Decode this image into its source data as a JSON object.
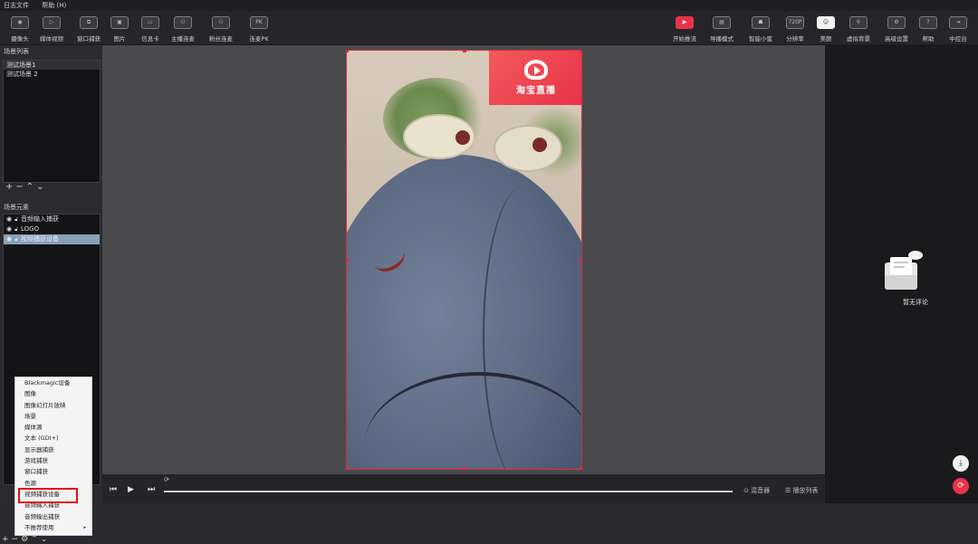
{
  "menu": [
    "日志文件",
    "帮助 (H)"
  ],
  "toolbar_left": [
    {
      "label": "摄像头",
      "icon": "camera-icon",
      "glyph": "◉"
    },
    {
      "label": "媒体视频",
      "icon": "media-play-icon",
      "glyph": "▷"
    },
    {
      "label": "窗口捕获",
      "icon": "window-capture-icon",
      "glyph": "⧉"
    },
    {
      "label": "图片",
      "icon": "image-icon",
      "glyph": "▣"
    },
    {
      "label": "信息卡",
      "icon": "info-card-icon",
      "glyph": "▭"
    },
    {
      "label": "主播连麦",
      "icon": "host-link-icon",
      "glyph": "⚇"
    },
    {
      "label": "粉丝连麦",
      "icon": "fan-link-icon",
      "glyph": "⚇"
    },
    {
      "label": "连麦PK",
      "icon": "pk-icon",
      "glyph": "PK"
    }
  ],
  "toolbar_right": [
    {
      "label": "开始推流",
      "icon": "start-stream-icon",
      "glyph": "▶",
      "style": "red"
    },
    {
      "label": "导播模式",
      "icon": "director-mode-icon",
      "glyph": "▤",
      "style": ""
    },
    {
      "label": "智能小蜜",
      "icon": "assistant-icon",
      "glyph": "☗",
      "style": ""
    },
    {
      "label": "分辨率",
      "icon": "resolution-icon",
      "glyph": "720P",
      "style": ""
    },
    {
      "label": "美颜",
      "icon": "beauty-icon",
      "glyph": "☺",
      "style": "white"
    },
    {
      "label": "虚拟背景",
      "icon": "virtual-bg-icon",
      "glyph": "⚲",
      "style": ""
    },
    {
      "label": "高级设置",
      "icon": "settings-icon",
      "glyph": "⚙",
      "style": ""
    },
    {
      "label": "帮助",
      "icon": "help-icon",
      "glyph": "?",
      "style": ""
    },
    {
      "label": "中控台",
      "icon": "console-icon",
      "glyph": "⇥",
      "style": ""
    }
  ],
  "scenes": {
    "title": "场景列表",
    "items": [
      "测试场景1",
      "测试场景 2"
    ]
  },
  "elements": {
    "title": "场景元素",
    "items": [
      "音频输入捕获",
      "LOGO",
      "视频捕获设备"
    ]
  },
  "context_menu": [
    "Blackmagic设备",
    "图像",
    "图像幻灯片放映",
    "场景",
    "媒体源",
    "文本 (GDI+)",
    "显示器捕获",
    "游戏捕获",
    "窗口捕获",
    "色源",
    "视频捕获设备",
    "音频输入捕获",
    "音频输出捕获",
    "不推荐使用"
  ],
  "highlighted_item": "视频捕获设备",
  "logo_text": "淘宝直播",
  "playbar": {
    "mixer": "混音器",
    "playlist": "播放列表"
  },
  "right_panel": {
    "empty_text": "暂无评论"
  }
}
